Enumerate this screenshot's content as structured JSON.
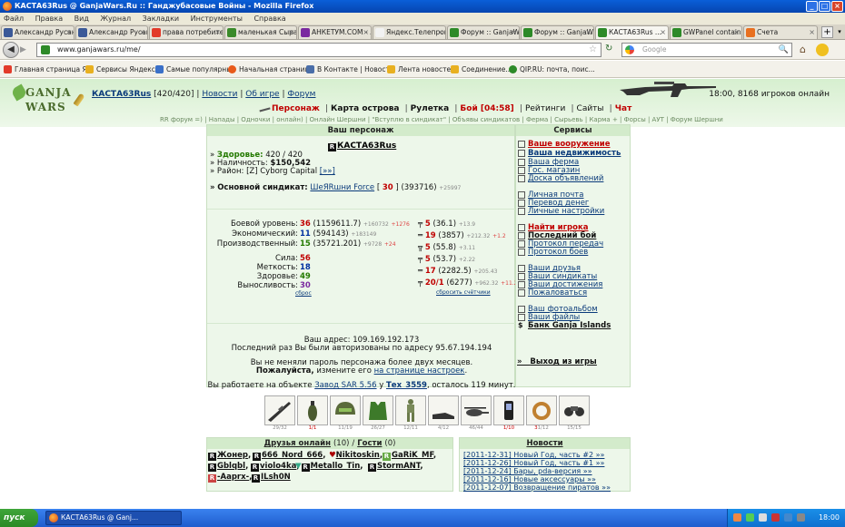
{
  "window": {
    "title": "КАСТА63Rus @ GanjaWars.Ru :: Ганджубасовые Войны - Mozilla Firefox",
    "min": "_",
    "max": "□",
    "close": "×"
  },
  "menu": [
    "Файл",
    "Правка",
    "Вид",
    "Журнал",
    "Закладки",
    "Инструменты",
    "Справка"
  ],
  "tabs": [
    {
      "label": "Александр Русан...",
      "color": "#3b5998"
    },
    {
      "label": "Александр Русан...",
      "color": "#3b5998"
    },
    {
      "label": "права потребите...",
      "color": "#e23a2a"
    },
    {
      "label": "маленькая Сырая...",
      "color": "#3a8a2a"
    },
    {
      "label": "АНКЕТУМ.COM - ...",
      "color": "#7a2aa0"
    },
    {
      "label": "Яндекс.Телепрог...",
      "color": "#f2f2f2"
    },
    {
      "label": "Форум :: GanjaWa...",
      "color": "#2d8a28"
    },
    {
      "label": "Форум :: GanjaWa...",
      "color": "#2d8a28"
    },
    {
      "label": "КАСТА63Rus ...",
      "color": "#2d8a28"
    },
    {
      "label": "GWPanel container",
      "color": "#2d8a28"
    },
    {
      "label": "Счета",
      "color": "#e87020"
    }
  ],
  "tab_close": "×",
  "tab_new": "+",
  "tab_list": "▾",
  "nav": {
    "url": "www.ganjawars.ru/me/",
    "search_placeholder": "Google",
    "back": "◀",
    "forward": "▶",
    "reload": "↻",
    "star": "☆",
    "search_go": "🔍",
    "home": "⌂"
  },
  "bookmarks": [
    {
      "label": "Главная страница Я...",
      "color": "#e23a2a"
    },
    {
      "label": "Сервисы Яндекса",
      "color": "#e8b020"
    },
    {
      "label": "Самые популярные",
      "color": "#3b70c8"
    },
    {
      "label": "Начальная страница",
      "color": "#e85a1a"
    },
    {
      "label": "В Контакте | Новости",
      "color": "#4a6ea8"
    },
    {
      "label": "Лента новостей",
      "color": "#e8b020"
    },
    {
      "label": "Соединение...",
      "color": "#e8b020"
    },
    {
      "label": "QIP.RU: почта, поис...",
      "color": "#2d8a28"
    }
  ],
  "header": {
    "logo_top": "GANJA",
    "logo_bottom": "WARS",
    "nick": "КАСТА63Rus",
    "hp_short": "[420/420]",
    "links": [
      "Новости",
      "Об игре",
      "Форум"
    ],
    "sep": "|",
    "online": "18:00, 8168 игроков онлайн"
  },
  "mainnav": {
    "items": [
      "Персонаж",
      "Карта острова",
      "Рулетка",
      "Бой [04:58]",
      "Рейтинги",
      "Сайты",
      "Чат"
    ],
    "sep": "|"
  },
  "subnav": "RR форум =) | Напады | Одночки | онлайн) | Онлайн Шершни | \"Вступлю в синдикат\" | Объявы синдикатов | Ферма | Сырьевь | Карма + | Форсы | АУТ | Форум Шершни",
  "character": {
    "panel_title": "Ваш персонаж",
    "badge": "R",
    "name": "КАСТА63Rus",
    "bullet": "»",
    "health_label": "Здоровье:",
    "health": "420 / 420",
    "cash_label": "Наличность:",
    "cash": "$150,542",
    "district_label": "Район:",
    "district": "[Z] Cyborg Capital",
    "district_link": "[»»]",
    "syndicate_label": "Основной синдикат:",
    "syndicate": "ШеЯRшни Force",
    "synd_bracket_open": "[",
    "synd_level": "30",
    "synd_bracket_close": "]",
    "synd_exp": "(393716)",
    "synd_exp_plus": "+25997",
    "levels": [
      {
        "label": "Боевой уровень:",
        "value": "36",
        "exp": "(1159611.7)",
        "small": "+160732",
        "plus": "+1276"
      },
      {
        "label": "Экономический:",
        "value": "11",
        "exp": "(594143)",
        "small": "+183149",
        "plus": ""
      },
      {
        "label": "Производственный:",
        "value": "15",
        "exp": "(35721.201)",
        "small": "+9728",
        "plus": "+24"
      }
    ],
    "stats": [
      {
        "label": "Сила:",
        "value": "56"
      },
      {
        "label": "Меткость:",
        "value": "18"
      },
      {
        "label": "Здоровье:",
        "value": "49"
      },
      {
        "label": "Выносливость:",
        "value": "30"
      }
    ],
    "stats_reset": "сброс",
    "skills": [
      {
        "value": "5",
        "exp": "(36.1)",
        "small": "+13.9",
        "plus": ""
      },
      {
        "value": "19",
        "exp": "(3857)",
        "small": "+212.32",
        "plus": "+1.2"
      },
      {
        "value": "5",
        "exp": "(55.8)",
        "small": "+3.11",
        "plus": ""
      },
      {
        "value": "5",
        "exp": "(53.7)",
        "small": "+2.22",
        "plus": ""
      },
      {
        "value": "17",
        "exp": "(2282.5)",
        "small": "+205.43",
        "plus": ""
      },
      {
        "value": "20/1",
        "exp": "(6277)",
        "small": "+962.32",
        "plus": "+11.2"
      }
    ],
    "skills_reset": "сбросить счётчики",
    "address": "Ваш адрес: 109.169.192.173",
    "last_login": "Последний раз Вы были авторизованы по адресу 95.67.194.194",
    "pwd_note": "Вы не меняли пароль персонажа более двух месяцев.",
    "pwd_please": "Пожалуйста,",
    "pwd_change": "измените его",
    "pwd_link": "на странице настроек",
    "pwd_dot": ".",
    "work_prefix": "Вы работаете на объекте",
    "work_obj": "Завод SAR 5.56",
    "work_mid": "у",
    "work_owner": "Тех_3559",
    "work_suffix": ", осталось 119 минут."
  },
  "services": {
    "title": "Сервисы",
    "items": [
      "Ваше вооружение",
      "Ваша недвижимость",
      "Ваша ферма",
      "Гос. магазин",
      "Доска объявлений",
      "Личная почта",
      "Перевод денег",
      "Личные настройки",
      "Найти игрока",
      "Последний бой",
      "Протокол передач",
      "Протокол боев",
      "Ваши друзья",
      "Ваши синдикаты",
      "Ваши достижения",
      "Пожаловаться",
      "Ваш фотоальбом",
      "Ваши файлы",
      "Банк Ganja Islands"
    ],
    "bank_symbol": "$",
    "exit_arrow": "»",
    "exit": "Выход из игры"
  },
  "equipment": [
    {
      "count": "29/32",
      "red": ""
    },
    {
      "count": "",
      "red": "1/1"
    },
    {
      "count": "11/19",
      "red": ""
    },
    {
      "count": "26/27",
      "red": ""
    },
    {
      "count": "12/11",
      "red": ""
    },
    {
      "count": "4/12",
      "red": ""
    },
    {
      "count": "46/44",
      "red": ""
    },
    {
      "count": "",
      "red": "1/10"
    },
    {
      "count": "1/12",
      "red": "3"
    },
    {
      "count": "15/15",
      "red": ""
    }
  ],
  "friends": {
    "title": "Друзья онлайн",
    "count": "(10)",
    "sep": "/",
    "guests": "Гости",
    "guests_count": "(0)",
    "list": [
      "Жонер",
      "666_Nord_666",
      "Nikitoskin",
      "GaRiK_MF",
      "Gblqbl",
      "violo4ka",
      "Metallo_Tin",
      "StormANT",
      "-Aaprx-",
      "ILsh0N"
    ],
    "comma": ",",
    "badge": "R"
  },
  "news": {
    "title": "Новости",
    "items": [
      "[2011-12-31] Новый Год, часть #2 »»",
      "[2011-12-26] Новый Год, часть #1 »»",
      "[2011-12-24] Бары, pda-версия »»",
      "[2011-12-16] Новые аксессуары »»",
      "[2011-12-07] Возвращение пиратов »»"
    ]
  },
  "taskbar": {
    "start": "пуск",
    "task": "КАСТА63Rus @ Ganj...",
    "clock": "18:00"
  }
}
